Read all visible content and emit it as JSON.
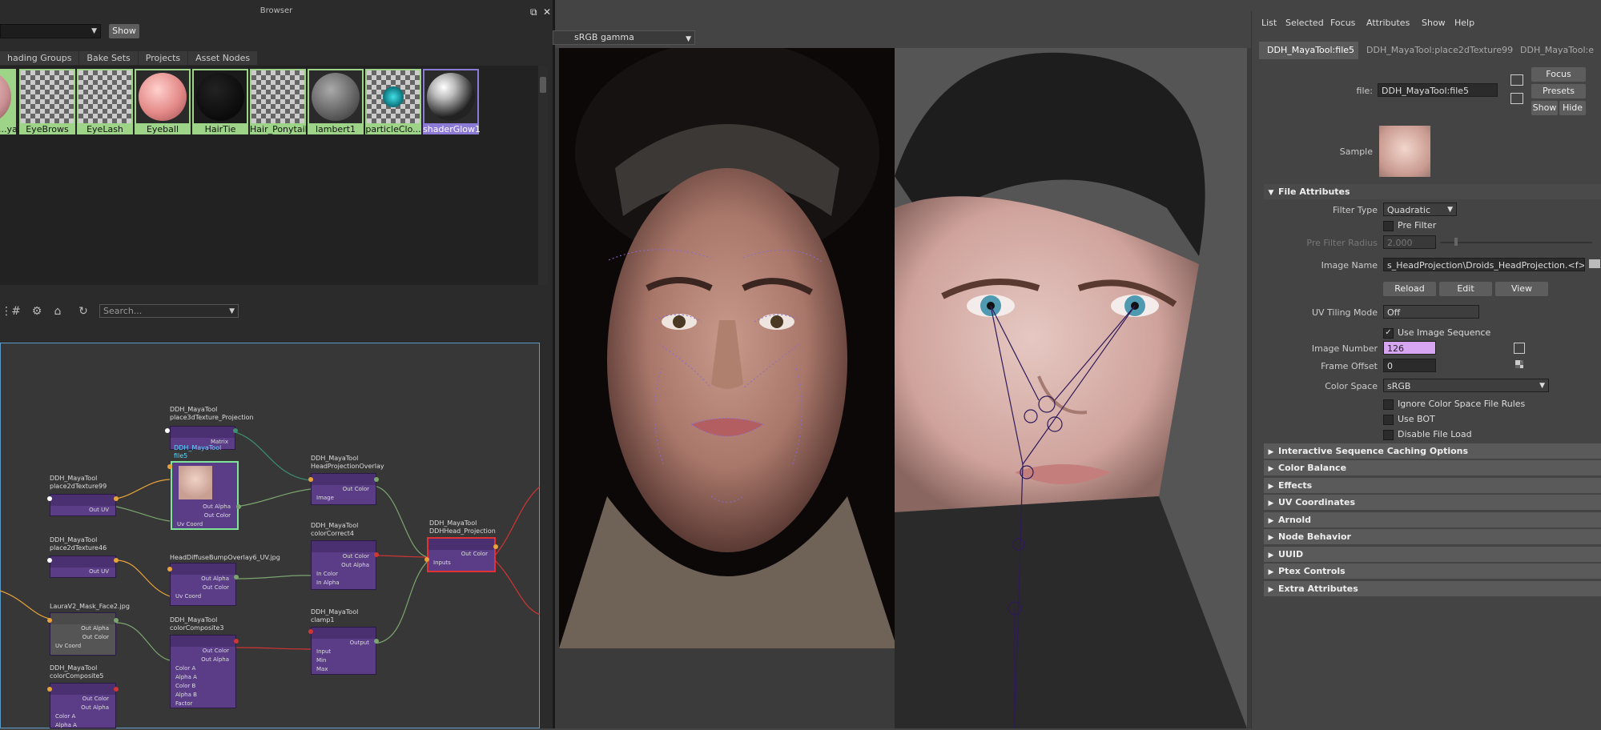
{
  "browser": {
    "title": "Browser",
    "show_label": "Show",
    "tabs": [
      "hading Groups",
      "Bake Sets",
      "Projects",
      "Asset Nodes"
    ],
    "swatches": [
      {
        "label": "...ya...",
        "style": "pink"
      },
      {
        "label": "EyeBrows",
        "style": "checker"
      },
      {
        "label": "EyeLash",
        "style": "checker"
      },
      {
        "label": "Eyeball",
        "style": "pinkball"
      },
      {
        "label": "HairTie",
        "style": "black"
      },
      {
        "label": "Hair_Ponytail",
        "style": "checker"
      },
      {
        "label": "lambert1",
        "style": "grey"
      },
      {
        "label": "particleClo...",
        "style": "cyan"
      },
      {
        "label": "shaderGlow1",
        "style": "white"
      }
    ]
  },
  "node_editor": {
    "search_placeholder": "Search...",
    "nodes": [
      {
        "id": "p3d",
        "title1": "DDH_MayaTool",
        "title2": "place3dTexture_Projection",
        "rows": [
          "Matrix"
        ]
      },
      {
        "id": "file5",
        "title1": "DDH_MayaTool",
        "title2": "file5",
        "rows": [
          "Out Alpha",
          "Out Color",
          "Uv Coord"
        ]
      },
      {
        "id": "p2d99",
        "title1": "DDH_MayaTool",
        "title2": "place2dTexture99",
        "rows": [
          "Out UV"
        ]
      },
      {
        "id": "p2d46",
        "title1": "DDH_MayaTool",
        "title2": "place2dTexture46",
        "rows": [
          "Out UV"
        ]
      },
      {
        "id": "hdb",
        "title1": "HeadDiffuseBumpOverlay6_UV.jpg",
        "title2": "",
        "rows": [
          "Out Alpha",
          "Out Color",
          "Uv Coord"
        ]
      },
      {
        "id": "hpo",
        "title1": "DDH_MayaTool",
        "title2": "HeadProjectionOverlay",
        "rows": [
          "Out Color",
          "Image"
        ]
      },
      {
        "id": "cc4",
        "title1": "DDH_MayaTool",
        "title2": "colorCorrect4",
        "rows": [
          "Out Color",
          "Out Alpha",
          "In Color",
          "In Alpha"
        ]
      },
      {
        "id": "dhp",
        "title1": "DDH_MayaTool",
        "title2": "DDHHead_Projection",
        "rows": [
          "Out Color",
          "Inputs"
        ]
      },
      {
        "id": "mask",
        "title1": "LauraV2_Mask_Face2.jpg",
        "title2": "",
        "rows": [
          "Out Alpha",
          "Out Color",
          "Uv Coord"
        ]
      },
      {
        "id": "cc3",
        "title1": "DDH_MayaTool",
        "title2": "colorComposite3",
        "rows": [
          "Out Color",
          "Out Alpha",
          "Color A",
          "Alpha A",
          "Color B",
          "Alpha B",
          "Factor"
        ]
      },
      {
        "id": "clamp",
        "title1": "DDH_MayaTool",
        "title2": "clamp1",
        "rows": [
          "Output",
          "Input",
          "Min",
          "Max"
        ]
      },
      {
        "id": "cc5",
        "title1": "DDH_MayaTool",
        "title2": "colorComposite5",
        "rows": [
          "Out Color",
          "Out Alpha",
          "Color A",
          "Alpha A"
        ]
      }
    ]
  },
  "viewport": {
    "color_space": "sRGB gamma"
  },
  "attribute_editor": {
    "menu": [
      "List",
      "Selected",
      "Focus",
      "Attributes",
      "Show",
      "Help"
    ],
    "tabs": [
      "DDH_MayaTool:file5",
      "DDH_MayaTool:place2dTexture99",
      "DDH_MayaTool:e"
    ],
    "file_label": "file:",
    "file_value": "DDH_MayaTool:file5",
    "focus": "Focus",
    "presets": "Presets",
    "show": "Show",
    "hide": "Hide",
    "sample": "Sample",
    "file_attributes": "File Attributes",
    "filter_type_label": "Filter Type",
    "filter_type": "Quadratic",
    "pre_filter": "Pre Filter",
    "pre_filter_radius_label": "Pre Filter Radius",
    "pre_filter_radius": "2.000",
    "image_name_label": "Image Name",
    "image_name": "s_HeadProjection\\Droids_HeadProjection.<f>.tif",
    "reload": "Reload",
    "edit": "Edit",
    "view": "View",
    "uv_tiling_label": "UV Tiling Mode",
    "uv_tiling": "Off",
    "use_image_sequence": "Use Image Sequence",
    "image_number_label": "Image Number",
    "image_number": "126",
    "frame_offset_label": "Frame Offset",
    "frame_offset": "0",
    "color_space_label": "Color Space",
    "color_space": "sRGB",
    "ignore_cs": "Ignore Color Space File Rules",
    "use_bot": "Use BOT",
    "disable_load": "Disable File Load",
    "sections": [
      "Interactive Sequence Caching Options",
      "Color Balance",
      "Effects",
      "UV Coordinates",
      "Arnold",
      "Node Behavior",
      "UUID",
      "Ptex Controls",
      "Extra Attributes"
    ]
  }
}
